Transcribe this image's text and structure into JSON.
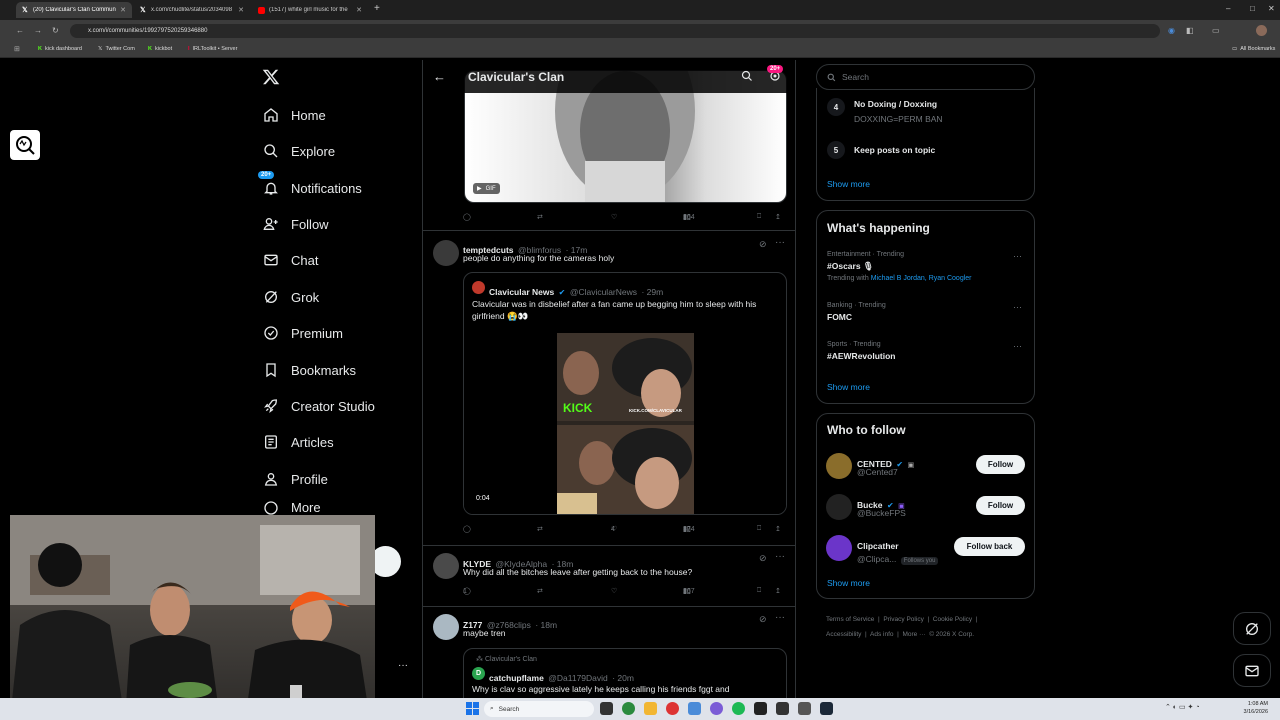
{
  "browser": {
    "tabs": [
      {
        "title": "(20) Clavicular's Clan Commun",
        "icon": "x-icon",
        "active": true
      },
      {
        "title": "x.com/chudlite/status/2034098",
        "icon": "x-icon",
        "active": false
      },
      {
        "title": "(1517) white girl music for the",
        "icon": "youtube-icon",
        "active": false
      }
    ],
    "url": "x.com/i/communities/1992797520259346880",
    "bookmarks": [
      "kick dashboard",
      "Twitter Com",
      "kickbot",
      "IRLToolkit • Server"
    ],
    "all_bookmarks": "All Bookmarks"
  },
  "nav": {
    "badge": "20+",
    "items": [
      "Home",
      "Explore",
      "Notifications",
      "Follow",
      "Chat",
      "Grok",
      "Premium",
      "Bookmarks",
      "Creator Studio",
      "Articles",
      "Profile",
      "More"
    ]
  },
  "header": {
    "title": "Clavicular's Clan",
    "badge": "20+"
  },
  "feed": {
    "gif_label": "GIF",
    "tweet0": {
      "views": "264"
    },
    "tweet1": {
      "name": "temptedcuts",
      "handle": "@blimforus",
      "time": "· 17m",
      "text": "people do anything for the cameras holy",
      "quote": {
        "name": "Clavicular News",
        "handle": "@ClavicularNews",
        "time": "· 29m",
        "text": "Clavicular was in disbelief after a fan came up begging him to sleep with his girlfriend 😭👀",
        "duration": "0:04",
        "overlay_brand": "KICK",
        "overlay_url": "KICK.COM/CLAVICULAR"
      },
      "likes": "4",
      "views": "374"
    },
    "tweet2": {
      "name": "KLYDE",
      "handle": "@KlydeAlpha",
      "time": "· 18m",
      "text": "Why did all the bitches leave after getting back to the house?",
      "replies": "1",
      "views": "267"
    },
    "tweet3": {
      "name": "Z177",
      "handle": "@z768clips",
      "time": "· 18m",
      "text": "maybe tren",
      "quote": {
        "community": "Clavicular's Clan",
        "name": "catchupflame",
        "handle": "@Da1179David",
        "time": "· 20m",
        "avatar_letter": "D",
        "text": "Why is clav so aggressive lately he keeps calling his friends fggt and"
      }
    }
  },
  "sidebar": {
    "search_placeholder": "Search",
    "rules": [
      {
        "num": "4",
        "title": "No Doxing / Doxxing",
        "desc": "DOXXING=PERM BAN"
      },
      {
        "num": "5",
        "title": "Keep posts on topic",
        "desc": ""
      }
    ],
    "show_more": "Show more",
    "happening": {
      "title": "What's happening",
      "trends": [
        {
          "context": "Entertainment · Trending",
          "name": "#Oscars 🎙",
          "with_label": "Trending with",
          "with": "Michael B Jordan, Ryan Coogler"
        },
        {
          "context": "Banking · Trending",
          "name": "FOMC"
        },
        {
          "context": "Sports · Trending",
          "name": "#AEWRevolution"
        }
      ]
    },
    "who": {
      "title": "Who to follow",
      "users": [
        {
          "name": "CENTED",
          "handle": "@Cented7",
          "button": "Follow",
          "follows_you": ""
        },
        {
          "name": "Bucke",
          "handle": "@BuckeFPS",
          "button": "Follow",
          "follows_you": ""
        },
        {
          "name": "Clipcather",
          "handle": "@Clipca...",
          "button": "Follow back",
          "follows_you": "Follows you"
        }
      ]
    },
    "footer": [
      "Terms of Service",
      "|",
      "Privacy Policy",
      "|",
      "Cookie Policy",
      "|",
      "Accessibility",
      "|",
      "Ads info",
      "|",
      "More ···",
      "© 2026 X Corp."
    ]
  },
  "taskbar": {
    "search": "Search",
    "time": "1:08 AM",
    "date": "3/16/2026"
  },
  "colors": {
    "accent": "#1d9bf0",
    "bg": "#000000",
    "border": "#2f3336",
    "muted": "#71767b"
  }
}
